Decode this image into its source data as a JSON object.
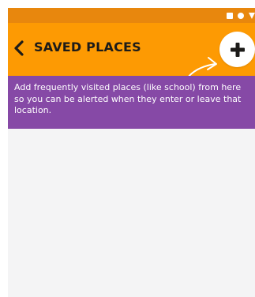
{
  "status_bar": {
    "icons": [
      "square-status-icon",
      "circle-status-icon",
      "triangle-status-icon"
    ],
    "background_color": "#e8870d"
  },
  "app_bar": {
    "title": "SAVED PLACES",
    "back_icon": "chevron-left-icon",
    "add_icon": "plus-icon",
    "background_color": "#fd9a03"
  },
  "info_banner": {
    "text": "Add frequently visited places (like school) from here so you can be alerted when they enter or leave that location.",
    "background_color": "#8649a6"
  },
  "content": {
    "background_color": "#f4f4f5"
  }
}
